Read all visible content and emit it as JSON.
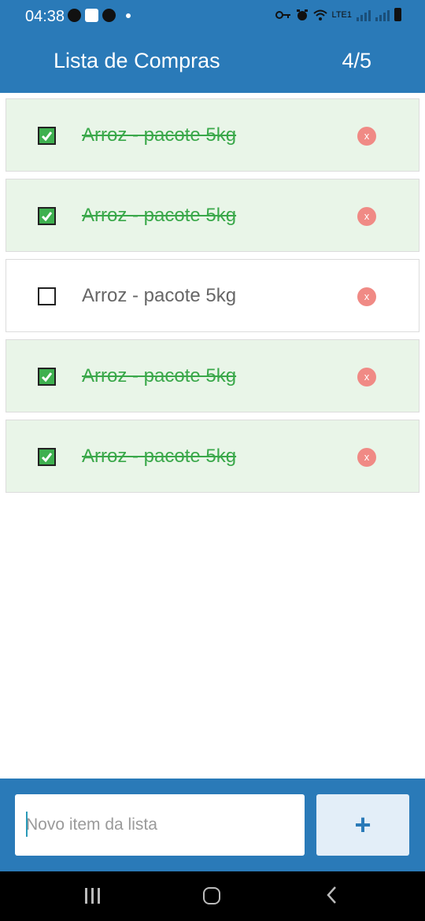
{
  "status_bar": {
    "time": "04:38",
    "icons": [
      "navigation-icon",
      "image-icon",
      "notification-icon",
      "key-icon",
      "alarm-icon",
      "wifi-icon",
      "signal-icon",
      "battery-icon"
    ],
    "network_label": "LTE1"
  },
  "app_bar": {
    "title": "Lista de Compras",
    "count": "4/5"
  },
  "items": [
    {
      "label": "Arroz - pacote 5kg",
      "checked": true
    },
    {
      "label": "Arroz - pacote 5kg",
      "checked": true
    },
    {
      "label": "Arroz - pacote 5kg",
      "checked": false
    },
    {
      "label": "Arroz - pacote 5kg",
      "checked": true
    },
    {
      "label": "Arroz - pacote 5kg",
      "checked": true
    }
  ],
  "delete_label": "x",
  "input": {
    "placeholder": "Novo item da lista",
    "value": ""
  },
  "add_button": {
    "label": "+"
  },
  "colors": {
    "primary": "#2a7ab8",
    "done_bg": "#e9f5e8",
    "done_text": "#3aa84a",
    "delete": "#f08a85"
  }
}
